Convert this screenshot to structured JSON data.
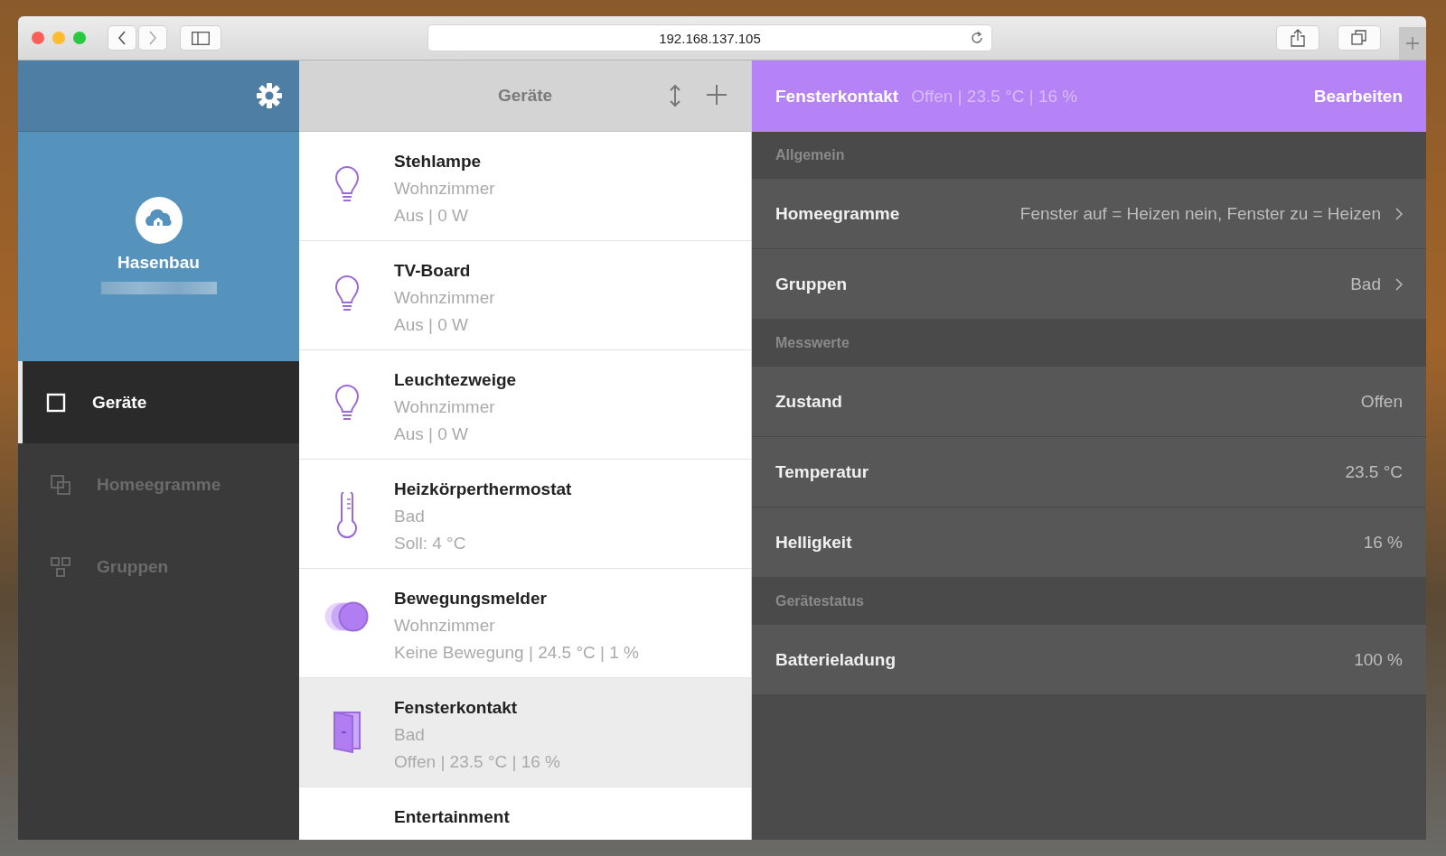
{
  "browser": {
    "url": "192.168.137.105"
  },
  "sidebar": {
    "account": {
      "name": "Hasenbau"
    },
    "items": [
      {
        "label": "Geräte",
        "selected": true
      },
      {
        "label": "Homeegramme",
        "selected": false
      },
      {
        "label": "Gruppen",
        "selected": false
      }
    ]
  },
  "device_list": {
    "title": "Geräte",
    "devices": [
      {
        "name": "Stehlampe",
        "room": "Wohnzimmer",
        "status": "Aus | 0 W",
        "kind": "lamp",
        "selected": false
      },
      {
        "name": "TV-Board",
        "room": "Wohnzimmer",
        "status": "Aus | 0 W",
        "kind": "lamp",
        "selected": false
      },
      {
        "name": "Leuchtezweige",
        "room": "Wohnzimmer",
        "status": "Aus | 0 W",
        "kind": "lamp",
        "selected": false
      },
      {
        "name": "Heizkörperthermostat",
        "room": "Bad",
        "status": "Soll: 4 °C",
        "kind": "thermostat",
        "selected": false
      },
      {
        "name": "Bewegungsmelder",
        "room": "Wohnzimmer",
        "status": "Keine Bewegung | 24.5 °C | 1 %",
        "kind": "motion",
        "selected": false
      },
      {
        "name": "Fensterkontakt",
        "room": "Bad",
        "status": "Offen | 23.5 °C | 16 %",
        "kind": "window",
        "selected": true
      },
      {
        "name": "Entertainment",
        "kind": "unknown",
        "selected": false
      }
    ]
  },
  "detail": {
    "title": "Fensterkontakt",
    "summary": "Offen | 23.5 °C | 16 %",
    "action": "Bearbeiten",
    "sections": [
      {
        "title": "Allgemein",
        "rows": [
          {
            "label": "Homeegramme",
            "value": "Fenster auf = Heizen nein, Fenster zu = Heizen",
            "link": true
          },
          {
            "label": "Gruppen",
            "value": "Bad",
            "link": true
          }
        ]
      },
      {
        "title": "Messwerte",
        "rows": [
          {
            "label": "Zustand",
            "value": "Offen",
            "link": false
          },
          {
            "label": "Temperatur",
            "value": "23.5 °C",
            "link": false
          },
          {
            "label": "Helligkeit",
            "value": "16 %",
            "link": false
          }
        ]
      },
      {
        "title": "Gerätestatus",
        "rows": [
          {
            "label": "Batterieladung",
            "value": "100 %",
            "link": false
          }
        ]
      }
    ]
  }
}
